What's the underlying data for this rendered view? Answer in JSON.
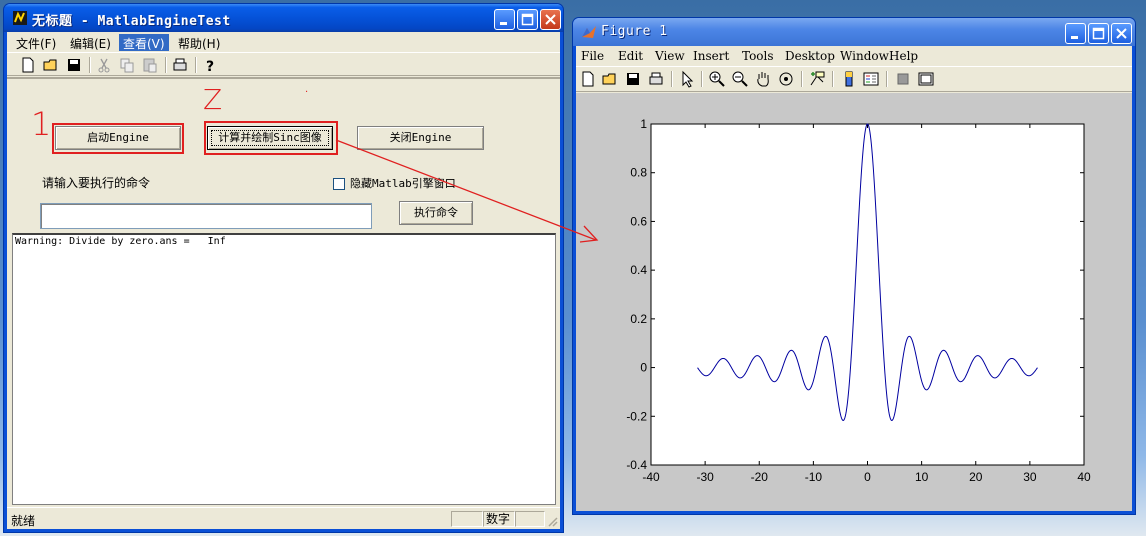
{
  "main_window": {
    "title": "无标题 - MatlabEngineTest",
    "menu": [
      {
        "label": "文件(F)"
      },
      {
        "label": "编辑(E)"
      },
      {
        "label": "查看(V)"
      },
      {
        "label": "帮助(H)"
      }
    ],
    "buttons": {
      "start": "启动Engine",
      "compute": "计算并绘制Sinc图像",
      "close": "关闭Engine",
      "execute": "执行命令"
    },
    "prompt_label": "请输入要执行的命令",
    "hide_checkbox_label": "隐藏Matlab引擎窗口",
    "command_input_value": "",
    "output_text": "Warning: Divide by zero.ans =   Inf",
    "status": {
      "ready": "就绪",
      "num": "数字"
    },
    "annotations": {
      "one": "1",
      "two": "Z"
    }
  },
  "figure_window": {
    "title": "Figure 1",
    "menu": [
      {
        "label": "File"
      },
      {
        "label": "Edit"
      },
      {
        "label": "View"
      },
      {
        "label": "Insert"
      },
      {
        "label": "Tools"
      },
      {
        "label": "Desktop"
      },
      {
        "label": "Window"
      },
      {
        "label": "Help"
      }
    ]
  },
  "colors": {
    "accent_red": "#e02020",
    "plot_line": "#0000a0"
  },
  "chart_data": {
    "type": "line",
    "title": "",
    "xlabel": "",
    "ylabel": "",
    "xlim": [
      -40,
      40
    ],
    "ylim": [
      -0.4,
      1
    ],
    "xticks": [
      "-40",
      "-30",
      "-20",
      "-10",
      "0",
      "10",
      "20",
      "30",
      "40"
    ],
    "yticks": [
      "-0.4",
      "-0.2",
      "0",
      "0.2",
      "0.4",
      "0.6",
      "0.8",
      "1"
    ],
    "grid": false,
    "series": [
      {
        "function": "sin(x)/x",
        "x_range": [
          -31.4,
          31.4
        ],
        "color": "#0000a0"
      }
    ]
  }
}
